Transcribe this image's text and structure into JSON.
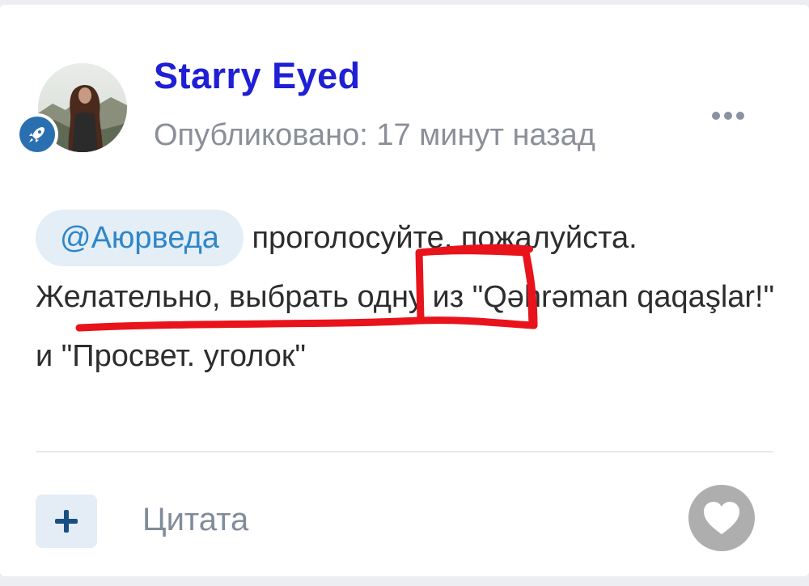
{
  "post": {
    "author_name": "Starry Eyed",
    "published": "Опубликовано: 17 минут назад",
    "mention": "@Аюрведа",
    "text_after_mention": " проголосуйте, пожалуйста. Желательно, выбрать одну из \"Qəhrəman qaqaşlar!\" и \"Просвет. уголок\""
  },
  "actions": {
    "quote_label": "Цитата"
  },
  "icons": {
    "avatar": "user-avatar",
    "badge": "rocket-icon",
    "more": "more-dots-icon",
    "add": "plus-icon",
    "like": "heart-icon"
  },
  "colors": {
    "author": "#1f1fd6",
    "mention_text": "#2f86c8",
    "mention_bg": "#e3eef7",
    "annotation": "#e8131b"
  }
}
